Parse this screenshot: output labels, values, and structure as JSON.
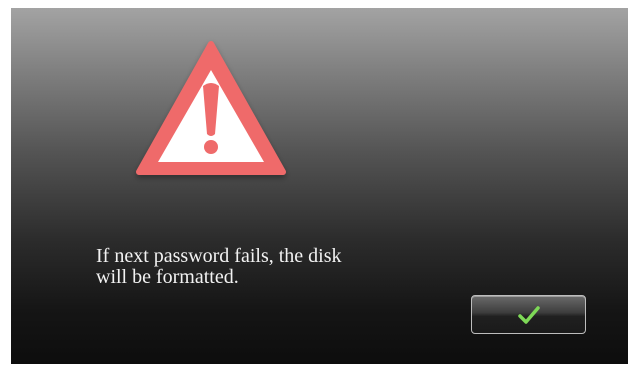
{
  "dialog": {
    "icon": "warning-triangle-icon",
    "icon_color": "#ef6b6b",
    "message": "If next password fails, the disk\nwill be formatted.",
    "confirm_icon": "checkmark-icon",
    "confirm_icon_color": "#7ed957"
  }
}
